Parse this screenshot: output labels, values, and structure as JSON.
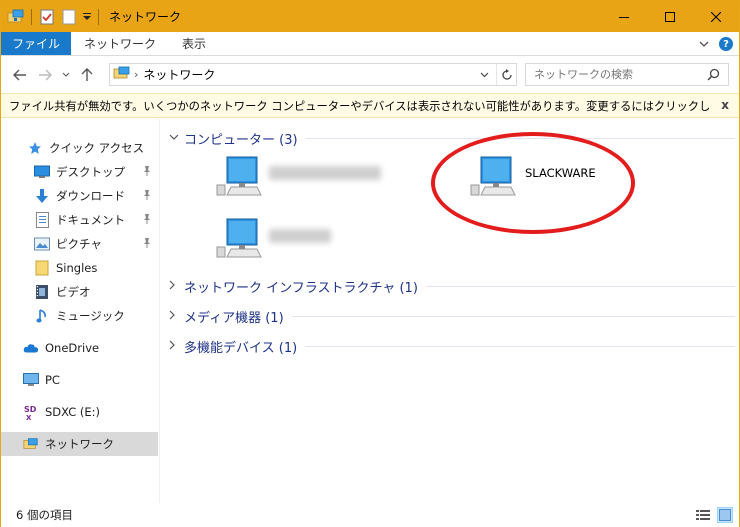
{
  "window": {
    "title": "ネットワーク",
    "minimize_icon": "minimize-icon",
    "maximize_icon": "maximize-icon",
    "close_icon": "close-icon"
  },
  "ribbon": {
    "tabs": [
      {
        "label": "ファイル",
        "active": true
      },
      {
        "label": "ネットワーク",
        "active": false
      },
      {
        "label": "表示",
        "active": false
      }
    ]
  },
  "address": {
    "path": "ネットワーク"
  },
  "search": {
    "placeholder": "ネットワークの検索"
  },
  "infobar": {
    "message": "ファイル共有が無効です。いくつかのネットワーク コンピューターやデバイスは表示されない可能性があります。変更するにはクリックしてください...",
    "close": "x"
  },
  "navpane": {
    "items": [
      {
        "label": "クイック アクセス",
        "icon": "star-icon"
      },
      {
        "label": "デスクトップ",
        "icon": "desktop-icon",
        "pinned": true
      },
      {
        "label": "ダウンロード",
        "icon": "download-icon",
        "pinned": true
      },
      {
        "label": "ドキュメント",
        "icon": "document-icon",
        "pinned": true
      },
      {
        "label": "ピクチャ",
        "icon": "pictures-icon",
        "pinned": true
      },
      {
        "label": "Singles",
        "icon": "folder-icon"
      },
      {
        "label": "ビデオ",
        "icon": "video-icon"
      },
      {
        "label": "ミュージック",
        "icon": "music-icon"
      },
      {
        "label": "OneDrive",
        "icon": "cloud-icon"
      },
      {
        "label": "PC",
        "icon": "pc-icon"
      },
      {
        "label": "SDXC (E:)",
        "icon": "sd-card-icon"
      },
      {
        "label": "ネットワーク",
        "icon": "network-icon",
        "selected": true
      }
    ]
  },
  "content": {
    "groups": [
      {
        "title": "コンピューター (3)",
        "expanded": true
      },
      {
        "title": "ネットワーク インフラストラクチャ (1)",
        "expanded": false
      },
      {
        "title": "メディア機器 (1)",
        "expanded": false
      },
      {
        "title": "多機能デバイス (1)",
        "expanded": false
      }
    ],
    "computers": [
      {
        "label": "",
        "blurred": true
      },
      {
        "label": "SLACKWARE",
        "blurred": false
      },
      {
        "label": "",
        "blurred": true
      }
    ]
  },
  "status": {
    "count": "6 個の項目"
  },
  "colors": {
    "titlebar": "#e8a414",
    "accent": "#1979ca",
    "highlight_circle": "#e31c1c",
    "group_title": "#1e3287"
  }
}
